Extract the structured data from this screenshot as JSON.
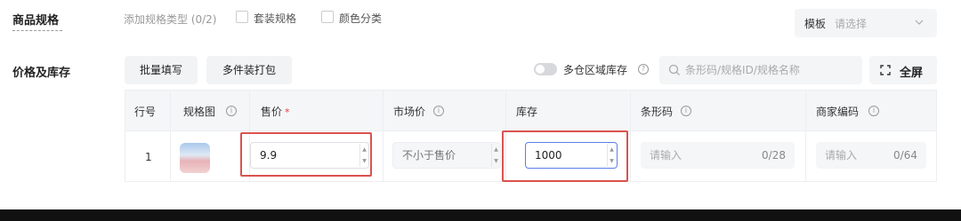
{
  "specs": {
    "label": "商品规格",
    "hint": "添加规格类型 (0/2)",
    "options": [
      {
        "label": "套装规格",
        "checked": false
      },
      {
        "label": "颜色分类",
        "checked": false
      }
    ],
    "template": {
      "label": "模板",
      "placeholder": "请选择"
    }
  },
  "price_stock": {
    "label": "价格及库存",
    "batch_fill_label": "批量填写",
    "bundle_label": "多件装打包",
    "multi_warehouse": {
      "label": "多仓区域库存",
      "enabled": false
    },
    "search_placeholder": "条形码/规格ID/规格名称",
    "fullscreen_label": "全屏"
  },
  "table": {
    "headers": {
      "row_no": "行号",
      "spec_image": "规格图",
      "price": "售价",
      "market_price": "市场价",
      "stock": "库存",
      "barcode": "条形码",
      "merchant_code": "商家编码"
    },
    "required_mark": "*",
    "rows": [
      {
        "row_no": "1",
        "price": "9.9",
        "market_price_placeholder": "不小于售价",
        "stock": "1000",
        "barcode_placeholder": "请输入",
        "barcode_count": "0/28",
        "merchant_code_placeholder": "请输入",
        "merchant_code_count": "0/64"
      }
    ]
  },
  "colors": {
    "accent": "#5b7fe8",
    "required": "#e3393c",
    "highlight_box": "#d9534f"
  }
}
